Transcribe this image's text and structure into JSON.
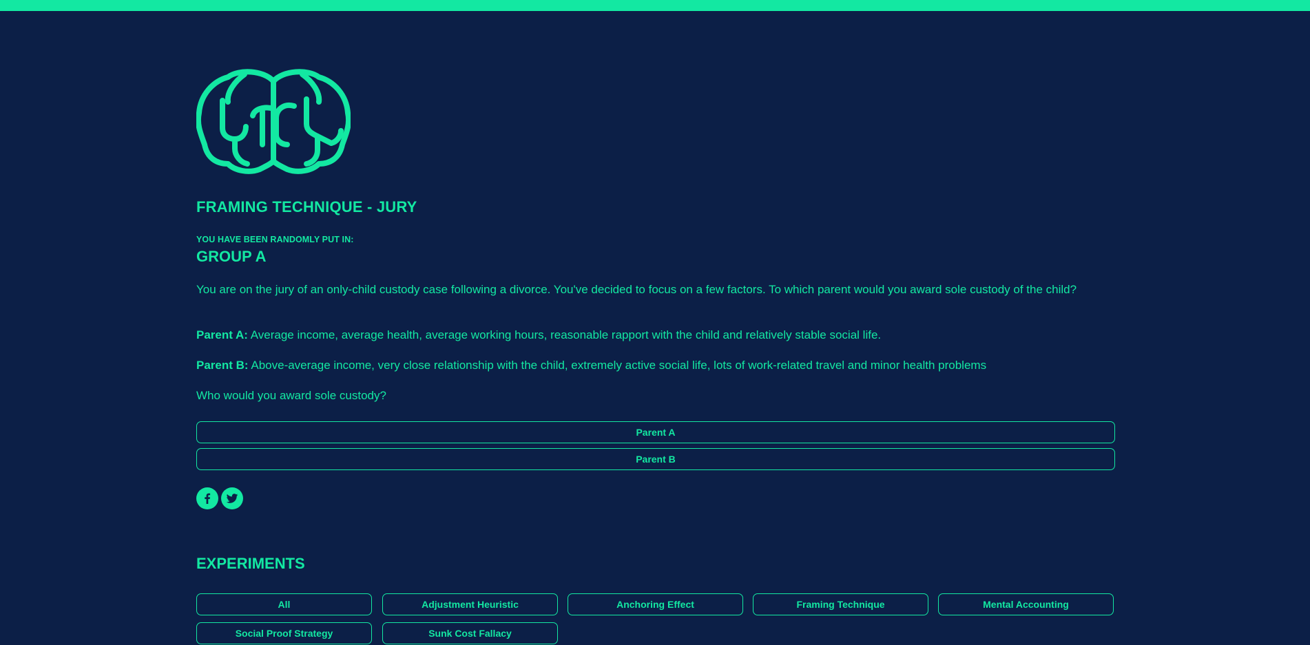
{
  "colors": {
    "background": "#0c1f47",
    "accent": "#13e8a2"
  },
  "logo": {
    "icon": "brain-icon"
  },
  "page": {
    "title": "FRAMING TECHNIQUE - JURY",
    "group_intro": "YOU HAVE BEEN RANDOMLY PUT IN:",
    "group_name": "GROUP A"
  },
  "question": {
    "intro": "You are on the jury of an only-child custody case following a divorce. You've decided to focus on a few factors. To which parent would you award sole custody of the child?",
    "parent_a_label": "Parent A:",
    "parent_a_text": " Average income, average health, average working hours, reasonable rapport with the child and relatively stable social life.",
    "parent_b_label": "Parent B:",
    "parent_b_text": " Above-average income, very close relationship with the child, extremely active social life, lots of work-related travel and minor health problems",
    "prompt": "Who would you award sole custody?"
  },
  "answers": {
    "option_a": "Parent A",
    "option_b": "Parent B"
  },
  "social": {
    "facebook_icon": "facebook-icon",
    "twitter_icon": "twitter-icon"
  },
  "experiments": {
    "title": "EXPERIMENTS",
    "filters": [
      "All",
      "Adjustment Heuristic",
      "Anchoring Effect",
      "Framing Technique",
      "Mental Accounting",
      "Social Proof Strategy",
      "Sunk Cost Fallacy"
    ]
  }
}
